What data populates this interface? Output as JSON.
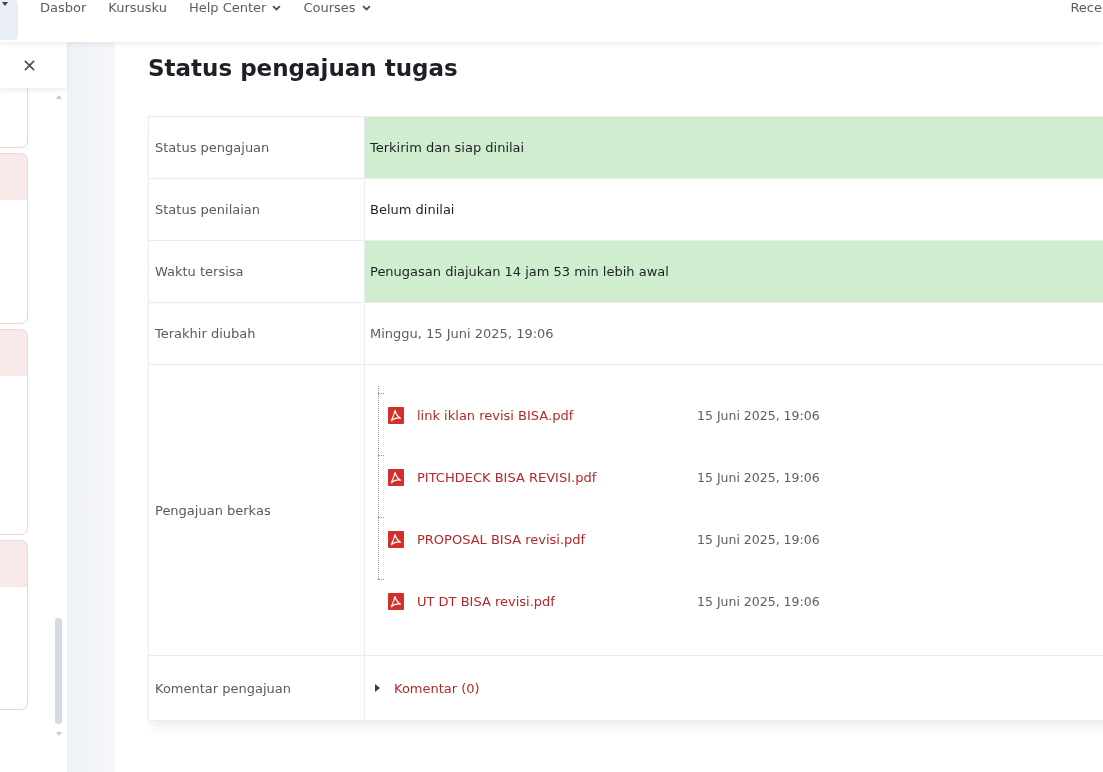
{
  "navbar": {
    "items": [
      {
        "label": "Dasbor",
        "has_menu": false
      },
      {
        "label": "Kursusku",
        "has_menu": false
      },
      {
        "label": "Help Center",
        "has_menu": true
      },
      {
        "label": "Courses",
        "has_menu": true
      }
    ],
    "end_label": "Rece"
  },
  "page_title": "Status pengajuan tugas",
  "table": {
    "rows": [
      {
        "kind": "text",
        "label": "Status pengajuan",
        "value": "Terkirim dan siap dinilai",
        "highlighted": true
      },
      {
        "kind": "text",
        "label": "Status penilaian",
        "value": "Belum dinilai",
        "highlighted": false
      },
      {
        "kind": "text",
        "label": "Waktu tersisa",
        "value": "Penugasan diajukan 14 jam 53 min lebih awal",
        "highlighted": true
      },
      {
        "kind": "date",
        "label": "Terakhir diubah",
        "value": "Minggu, 15 Juni 2025, 19:06",
        "highlighted": false
      },
      {
        "kind": "files",
        "label": "Pengajuan berkas",
        "files": [
          {
            "name": "link iklan revisi BISA.pdf",
            "date": "15 Juni 2025, 19:06"
          },
          {
            "name": "PITCHDECK BISA REVISI.pdf",
            "date": "15 Juni 2025, 19:06"
          },
          {
            "name": "PROPOSAL BISA revisi.pdf",
            "date": "15 Juni 2025, 19:06"
          },
          {
            "name": "UT DT BISA revisi.pdf",
            "date": "15 Juni 2025, 19:06"
          }
        ]
      },
      {
        "kind": "comments",
        "label": "Komentar pengajuan",
        "link": "Komentar (0)",
        "expanded": false
      }
    ]
  }
}
